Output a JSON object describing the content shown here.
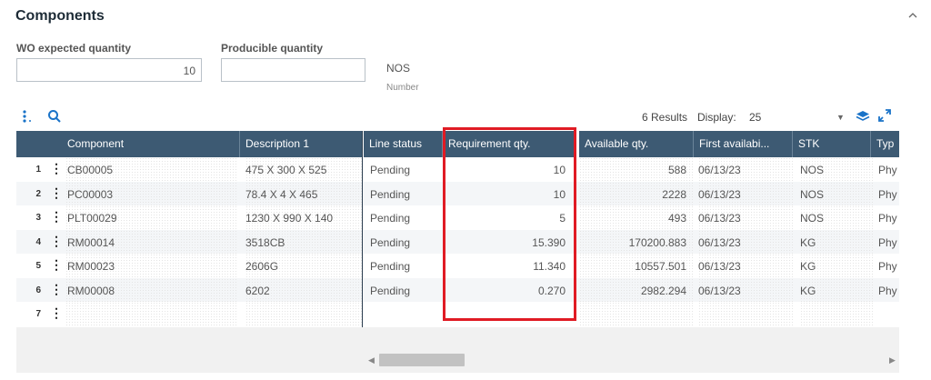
{
  "section": {
    "title": "Components"
  },
  "fields": {
    "wo_expected_quantity": {
      "label": "WO expected quantity",
      "value": "10"
    },
    "producible_quantity": {
      "label": "Producible quantity",
      "value": ""
    },
    "unit": "NOS",
    "unit_caption": "Number"
  },
  "toolbar": {
    "results": "6 Results",
    "display_label": "Display:",
    "display_value": "25"
  },
  "columns": [
    "Component",
    "Description 1",
    "Line status",
    "Requirement qty.",
    "Available qty.",
    "First availabi...",
    "STK",
    "Typ"
  ],
  "rows": [
    {
      "num": "1",
      "component": "CB00005",
      "description": "475 X 300 X 525",
      "status": "Pending",
      "req": "10",
      "avail": "588",
      "first": "06/13/23",
      "stk": "NOS",
      "type": "Phy"
    },
    {
      "num": "2",
      "component": "PC00003",
      "description": "78.4 X 4 X 465",
      "status": "Pending",
      "req": "10",
      "avail": "2228",
      "first": "06/13/23",
      "stk": "NOS",
      "type": "Phy"
    },
    {
      "num": "3",
      "component": "PLT00029",
      "description": "1230  X 990 X 140",
      "status": "Pending",
      "req": "5",
      "avail": "493",
      "first": "06/13/23",
      "stk": "NOS",
      "type": "Phy"
    },
    {
      "num": "4",
      "component": "RM00014",
      "description": "3518CB",
      "status": "Pending",
      "req": "15.390",
      "avail": "170200.883",
      "first": "06/13/23",
      "stk": "KG",
      "type": "Phy"
    },
    {
      "num": "5",
      "component": "RM00023",
      "description": "2606G",
      "status": "Pending",
      "req": "11.340",
      "avail": "10557.501",
      "first": "06/13/23",
      "stk": "KG",
      "type": "Phy"
    },
    {
      "num": "6",
      "component": "RM00008",
      "description": "6202",
      "status": "Pending",
      "req": "0.270",
      "avail": "2982.294",
      "first": "06/13/23",
      "stk": "KG",
      "type": "Phy"
    },
    {
      "num": "7",
      "component": "",
      "description": "",
      "status": "",
      "req": "",
      "avail": "",
      "first": "",
      "stk": "",
      "type": ""
    }
  ],
  "icons": {
    "collapse": "chevron-up-icon",
    "menu": "vertical-dots-icon",
    "search": "search-icon",
    "layers": "layers-icon",
    "expand": "expand-icon"
  },
  "colors": {
    "header_bg": "#3d5a73",
    "highlight": "#e01b24",
    "accent": "#1a73c8"
  }
}
